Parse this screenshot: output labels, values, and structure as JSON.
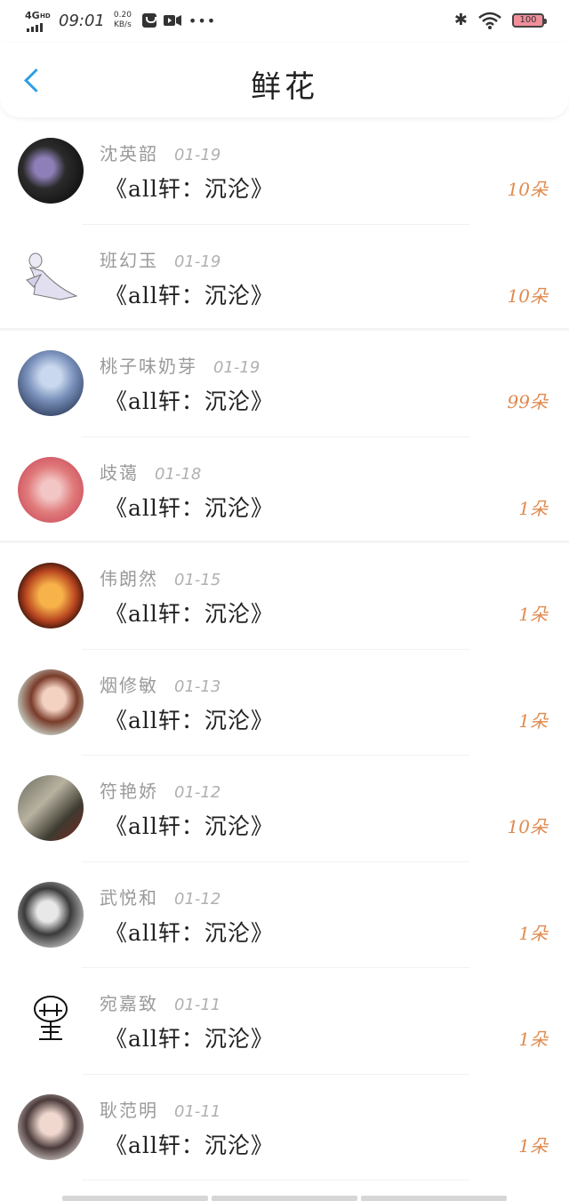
{
  "status": {
    "network": "4G",
    "network_hd": "HD",
    "time": "09:01",
    "speed_value": "0.20",
    "speed_unit": "KB/s",
    "battery": "100"
  },
  "header": {
    "title": "鲜花"
  },
  "rows": [
    {
      "name": "沈英韶",
      "date": "01-19",
      "work": "《all轩：沉沦》",
      "count": "10朵"
    },
    {
      "name": "班幻玉",
      "date": "01-19",
      "work": "《all轩：沉沦》",
      "count": "10朵"
    },
    {
      "name": "桃子味奶芽",
      "date": "01-19",
      "work": "《all轩：沉沦》",
      "count": "99朵"
    },
    {
      "name": "歧蔼",
      "date": "01-18",
      "work": "《all轩：沉沦》",
      "count": "1朵"
    },
    {
      "name": "伟朗然",
      "date": "01-15",
      "work": "《all轩：沉沦》",
      "count": "1朵"
    },
    {
      "name": "烟修敏",
      "date": "01-13",
      "work": "《all轩：沉沦》",
      "count": "1朵"
    },
    {
      "name": "符艳娇",
      "date": "01-12",
      "work": "《all轩：沉沦》",
      "count": "10朵"
    },
    {
      "name": "武悦和",
      "date": "01-12",
      "work": "《all轩：沉沦》",
      "count": "1朵"
    },
    {
      "name": "宛嘉致",
      "date": "01-11",
      "work": "《all轩：沉沦》",
      "count": "1朵"
    },
    {
      "name": "耿范明",
      "date": "01-11",
      "work": "《all轩：沉沦》",
      "count": "1朵"
    }
  ],
  "colors": {
    "accent": "#2d9fe3",
    "count": "#e08a4e"
  }
}
